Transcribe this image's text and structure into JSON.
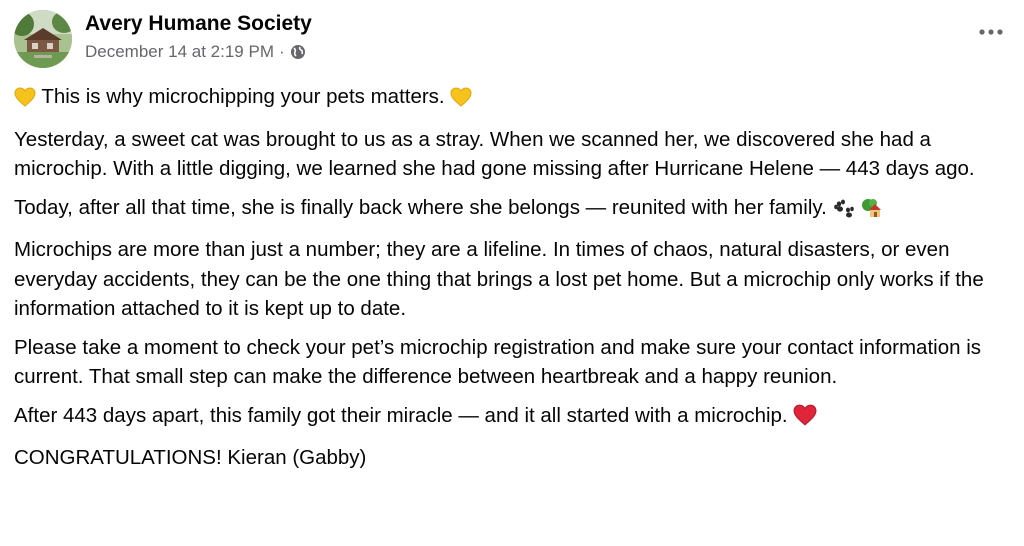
{
  "post": {
    "page_name": "Avery Humane Society",
    "timestamp": "December 14 at 2:19 PM",
    "separator": "·",
    "privacy_icon": "globe-icon",
    "more_icon": "more-options-icon",
    "paragraphs": {
      "p1": "This is why microchipping your pets matters.",
      "p2": "Yesterday, a sweet cat was brought to us as a stray. When we scanned her, we discovered she had a microchip. With a little digging, we learned she had gone missing after Hurricane Helene — 443 days ago.",
      "p3": "Today, after all that time, she is finally back where she belongs — reunited with her family.",
      "p4": "Microchips are more than just a number; they are a lifeline. In times of chaos, natural disasters, or even everyday accidents, they can be the one thing that brings a lost pet home. But a microchip only works if the information attached to it is kept up to date.",
      "p5": "Please take a moment to check your pet’s microchip registration and make sure your contact information is current. That small step can make the difference between heartbreak and a happy reunion.",
      "p6": "After 443 days apart, this family got their miracle — and it all started with a microchip.",
      "p7": "CONGRATULATIONS! Kieran (Gabby)"
    },
    "emojis": {
      "yellow_heart": "yellow-heart-emoji",
      "paw_prints": "paw-prints-emoji",
      "house": "house-with-garden-emoji",
      "red_heart": "red-heart-emoji"
    },
    "colors": {
      "text": "#050505",
      "secondary": "#65676b",
      "yellow_heart": "#f6c21c",
      "red_heart": "#e0243a"
    }
  }
}
